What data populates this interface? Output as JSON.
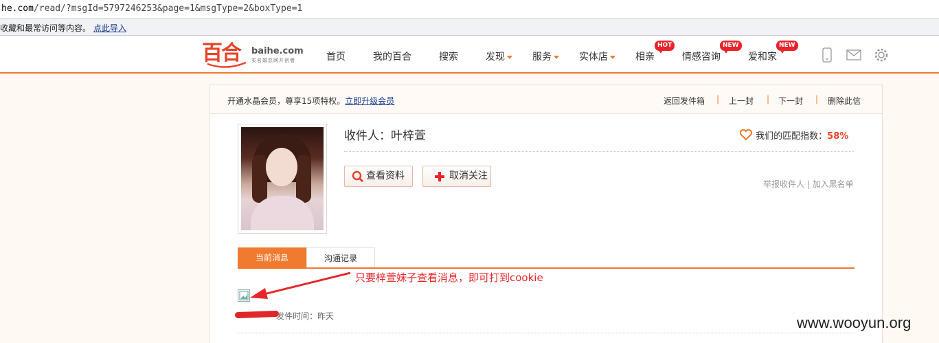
{
  "browser": {
    "address_host": "he.com",
    "address_path": "/read/?msgId=5797246253&page=1&msgType=2&boxType=1",
    "bookmark_text": "收藏和最常访问等内容。",
    "bookmark_link": "点此导入"
  },
  "header": {
    "logo_cn": "百合",
    "logo_en": "baihe.com",
    "logo_tagline": "实名婚恋网开创者",
    "nav": [
      {
        "label": "首页"
      },
      {
        "label": "我的百合"
      },
      {
        "label": "搜索"
      },
      {
        "label": "发现"
      },
      {
        "label": "服务"
      },
      {
        "label": "实体店"
      },
      {
        "label": "相亲",
        "badge": "HOT"
      },
      {
        "label": "情感咨询",
        "badge": "NEW"
      },
      {
        "label": "爱和家",
        "badge": "NEW"
      }
    ],
    "icons": [
      "phone-icon",
      "mail-icon",
      "settings-gear-icon"
    ]
  },
  "toolbar": {
    "promo_text": "开通水晶会员，尊享15项特权。",
    "promo_link": "立即升级会员",
    "actions": [
      "返回发件箱",
      "上一封",
      "下一封",
      "删除此信"
    ]
  },
  "profile": {
    "recipient": "收件人：叶梓萱",
    "match_label": "我们的匹配指数：",
    "match_value": "58%",
    "btn_view": "查看资料",
    "btn_unfollow": "取消关注",
    "report": "举报收件人 | 加入黑名单"
  },
  "tabs": [
    "当前消息",
    "沟通记录"
  ],
  "message": {
    "sent_label": "发件时间：昨天"
  },
  "annotation": "只要梓萱妹子查看消息，即可打到cookie",
  "watermark": "www.wooyun.org",
  "colors": {
    "accent": "#f07a2d",
    "brand_red": "#e8432a",
    "annotation_red": "#e8262a"
  }
}
